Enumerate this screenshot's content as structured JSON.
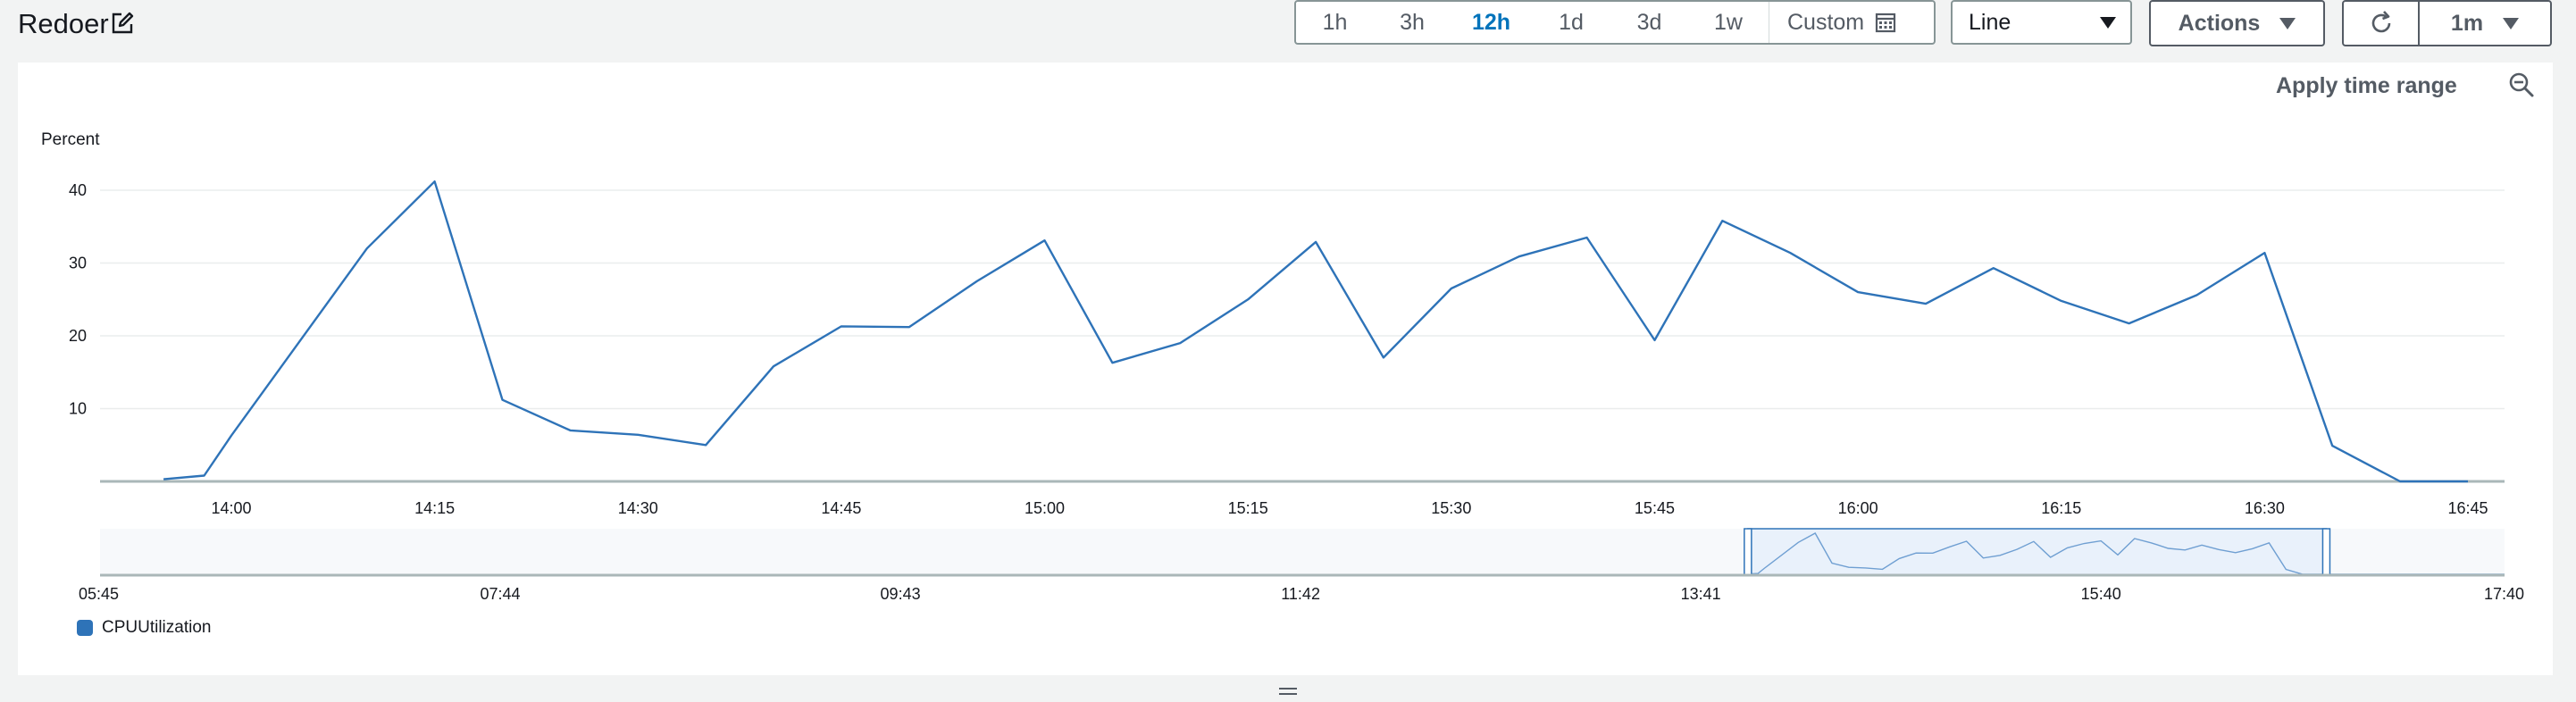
{
  "widget": {
    "title": "Redoer",
    "edit_icon": "edit-icon"
  },
  "time_range": {
    "options": [
      "1h",
      "3h",
      "12h",
      "1d",
      "3d",
      "1w"
    ],
    "selected": "12h",
    "custom_label": "Custom",
    "custom_icon": "calendar-icon"
  },
  "view_select": {
    "value": "Line"
  },
  "actions": {
    "label": "Actions"
  },
  "refresh": {
    "icon": "refresh-icon",
    "interval": "1m"
  },
  "panel": {
    "apply_range_label": "Apply time range",
    "zoom_icon": "zoom-out-icon"
  },
  "colors": {
    "series": "#2e73b8",
    "accent": "#0073bb",
    "grid": "#eaeded",
    "axis": "#aab7b8"
  },
  "chart_data": {
    "type": "line",
    "ylabel": "Percent",
    "y_ticks": [
      10,
      20,
      30,
      40
    ],
    "ylim": [
      0,
      45
    ],
    "x_ticks": [
      "14:00",
      "14:15",
      "14:30",
      "14:45",
      "15:00",
      "15:15",
      "15:30",
      "15:45",
      "16:00",
      "16:15",
      "16:30",
      "16:45"
    ],
    "grid": true,
    "legend_position": "bottom-left",
    "series": [
      {
        "name": "CPUUtilization",
        "color": "#2e73b8",
        "x": [
          "13:55",
          "13:58",
          "14:00",
          "14:10",
          "14:15",
          "14:20",
          "14:25",
          "14:30",
          "14:35",
          "14:40",
          "14:45",
          "14:50",
          "14:55",
          "15:00",
          "15:05",
          "15:10",
          "15:15",
          "15:20",
          "15:25",
          "15:30",
          "15:35",
          "15:40",
          "15:45",
          "15:50",
          "15:55",
          "16:00",
          "16:05",
          "16:10",
          "16:15",
          "16:20",
          "16:25",
          "16:30",
          "16:35",
          "16:40",
          "16:45"
        ],
        "values": [
          0.3,
          0.8,
          6.3,
          32,
          41.2,
          11.2,
          7,
          6.4,
          5,
          15.8,
          21.3,
          21.2,
          27.5,
          33.1,
          16.3,
          19,
          25,
          32.9,
          17,
          26.5,
          30.9,
          33.5,
          19.4,
          35.8,
          31.4,
          26,
          24.4,
          29.3,
          24.8,
          21.7,
          25.6,
          31.4,
          4.9,
          0,
          0
        ]
      }
    ],
    "overview": {
      "x_ticks": [
        "05:45",
        "07:44",
        "09:43",
        "11:42",
        "13:41",
        "15:40",
        "17:40"
      ],
      "selection": [
        "13:55",
        "16:47"
      ]
    }
  },
  "legend": {
    "items": [
      "CPUUtilization"
    ]
  }
}
